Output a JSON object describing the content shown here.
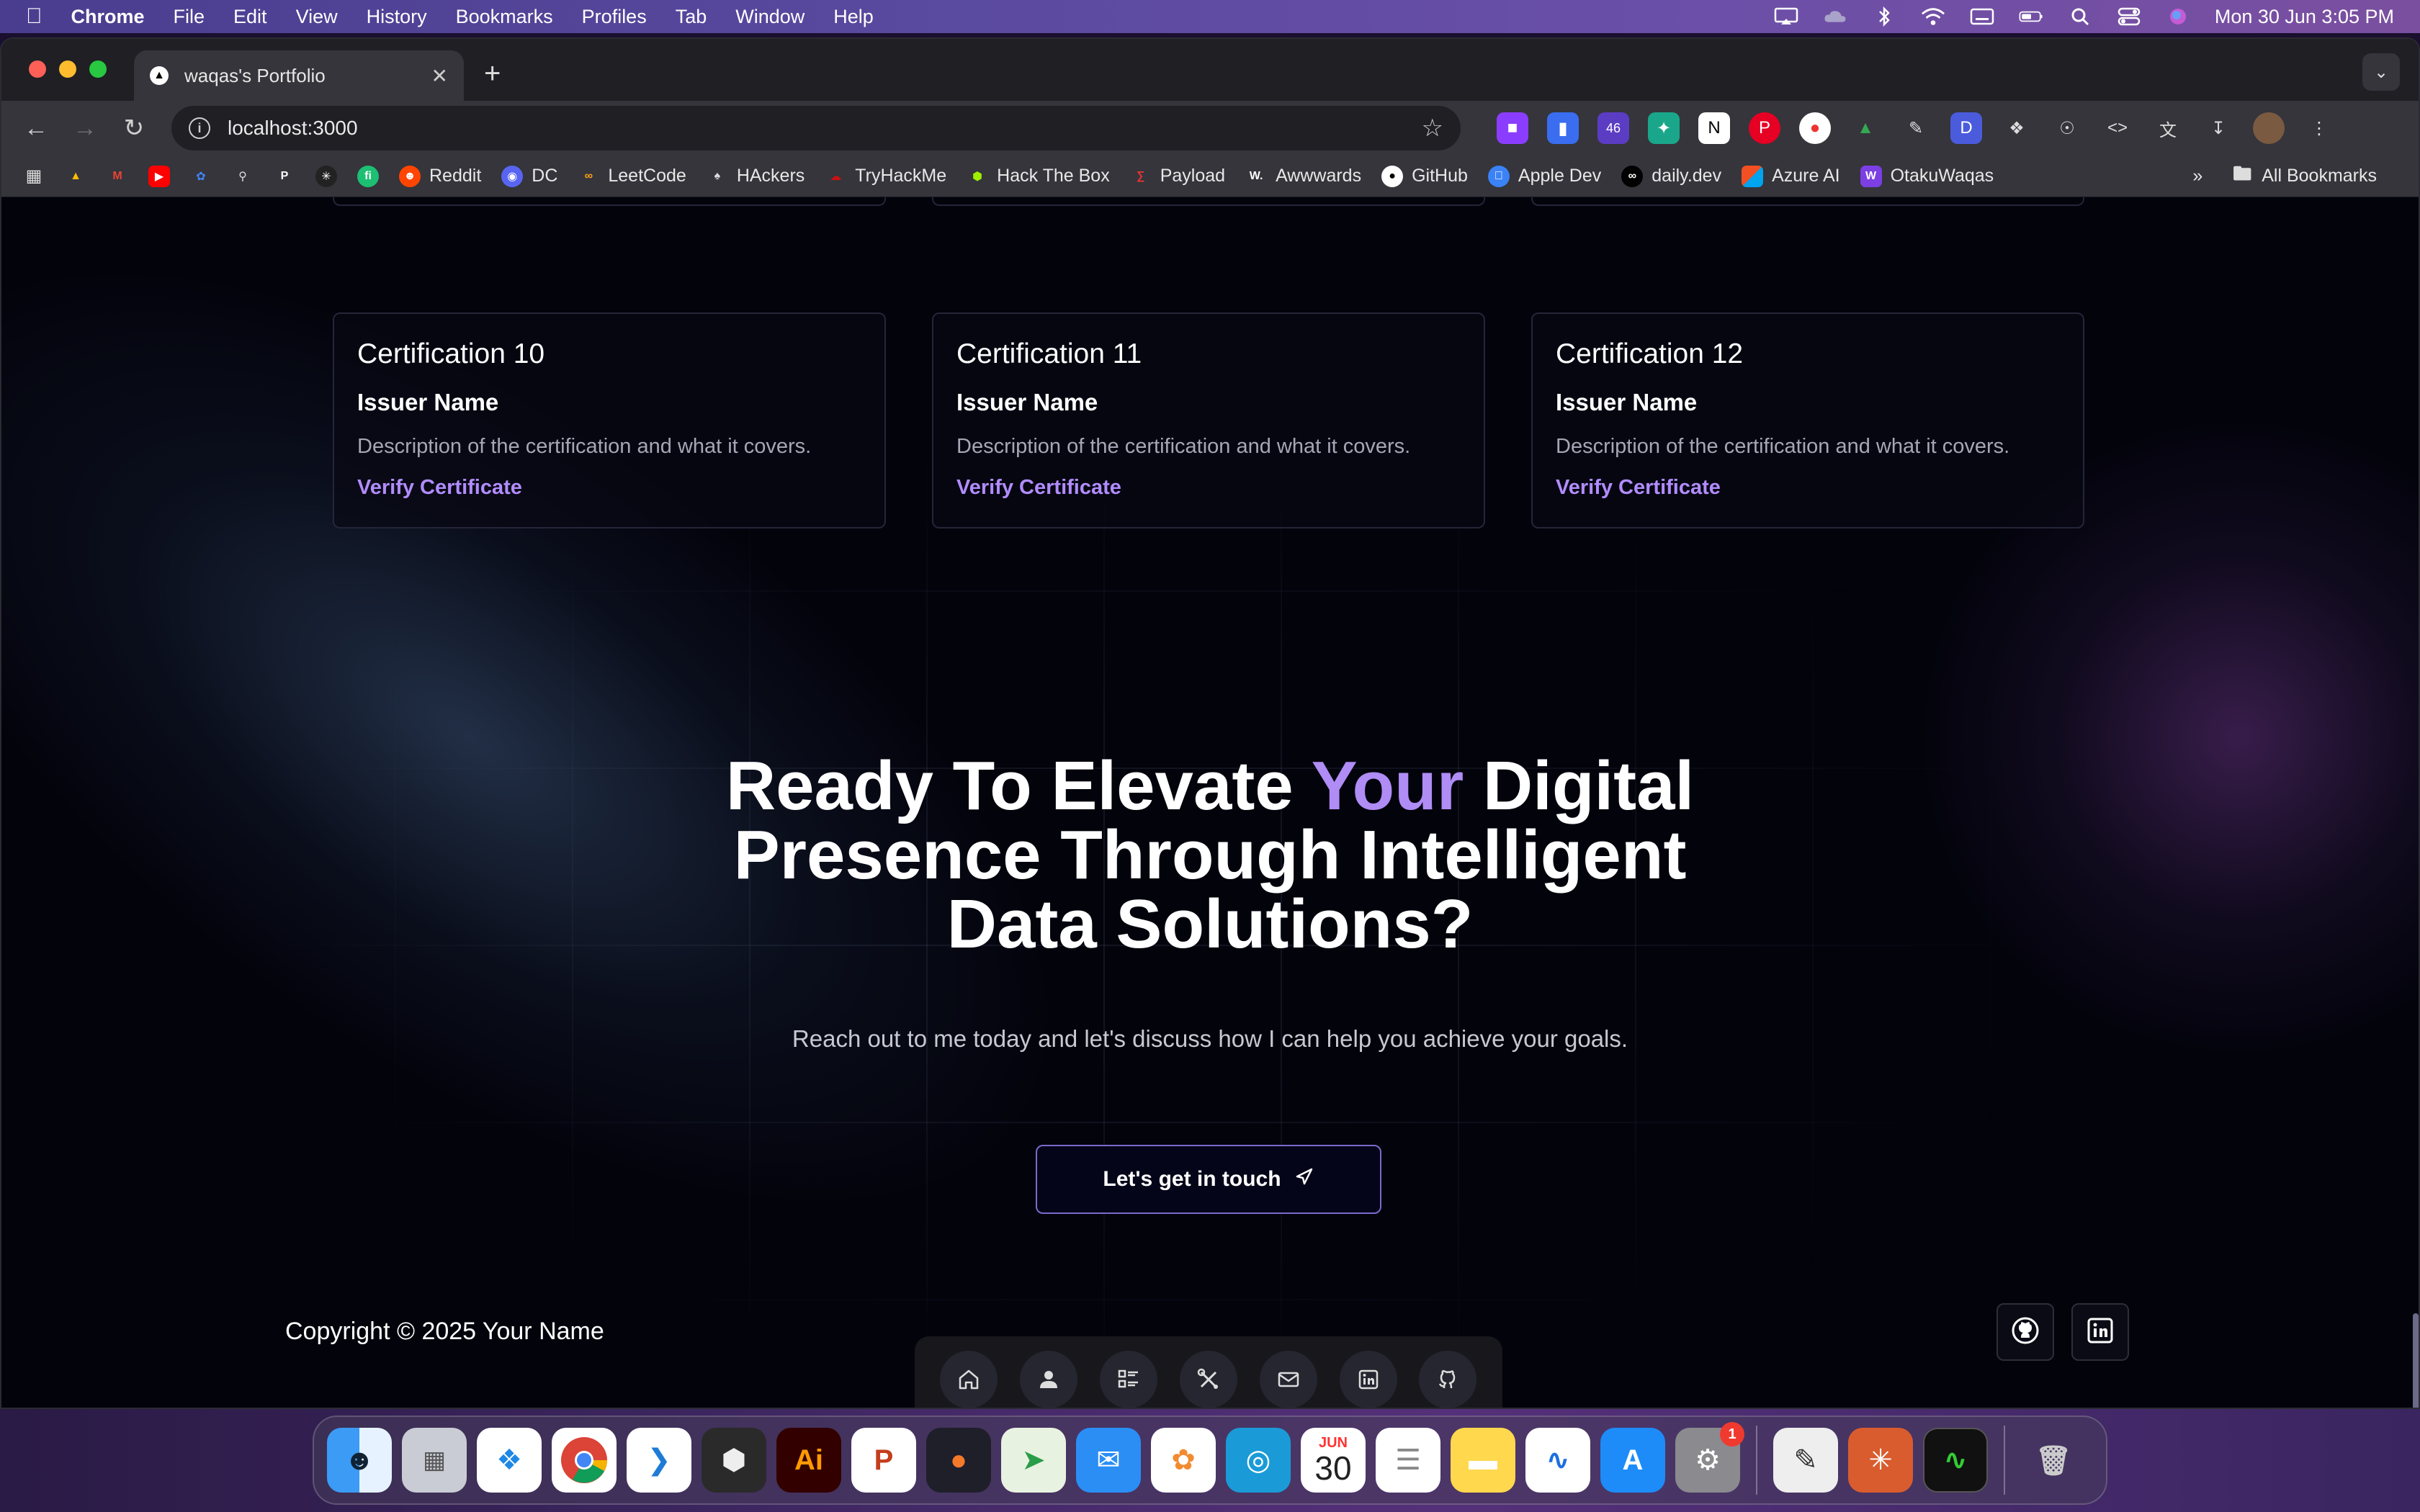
{
  "menubar": {
    "app": "Chrome",
    "items": [
      "File",
      "Edit",
      "View",
      "History",
      "Bookmarks",
      "Profiles",
      "Tab",
      "Window",
      "Help"
    ],
    "clock": "Mon 30 Jun  3:05 PM"
  },
  "browser": {
    "tab_title": "waqas's Portfolio",
    "url": "localhost:3000",
    "extension_badge": "46",
    "bookmarks": [
      "Reddit",
      "DC",
      "LeetCode",
      "HAckers",
      "TryHackMe",
      "Hack The Box",
      "Payload",
      "Awwwards",
      "GitHub",
      "Apple Dev",
      "daily.dev",
      "Azure AI",
      "OtakuWaqas"
    ],
    "all_bookmarks": "All Bookmarks"
  },
  "certifications": [
    {
      "title": "Certification 10",
      "issuer": "Issuer Name",
      "description": "Description of the certification and what it covers.",
      "link": "Verify Certificate"
    },
    {
      "title": "Certification 11",
      "issuer": "Issuer Name",
      "description": "Description of the certification and what it covers.",
      "link": "Verify Certificate"
    },
    {
      "title": "Certification 12",
      "issuer": "Issuer Name",
      "description": "Description of the certification and what it covers.",
      "link": "Verify Certificate"
    }
  ],
  "hero": {
    "line1_pre": "Ready To Elevate ",
    "line1_accent": "Your",
    "line1_post": " Digital",
    "line2": "Presence Through Intelligent",
    "line3": "Data Solutions?",
    "subtitle": "Reach out to me today and let's discuss how I can help you achieve your goals.",
    "cta": "Let's get in touch"
  },
  "footer": {
    "copyright": "Copyright © 2025 Your Name"
  },
  "dock": {
    "calendar_month": "JUN",
    "calendar_day": "30",
    "settings_badge": "1"
  },
  "colors": {
    "accent": "#b08cf5",
    "page_bg": "#03030c"
  }
}
